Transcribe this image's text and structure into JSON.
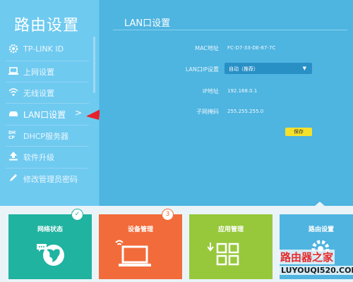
{
  "sidebar": {
    "title": "路由设置",
    "items": [
      {
        "label": "TP-LINK ID",
        "icon": "gear-icon"
      },
      {
        "label": "上网设置",
        "icon": "laptop-icon"
      },
      {
        "label": "无线设置",
        "icon": "wifi-icon"
      },
      {
        "label": "LAN口设置",
        "icon": "router-icon",
        "arrow": ">",
        "active": true
      },
      {
        "label": "DHCP服务器",
        "icon": "dhcp-icon"
      },
      {
        "label": "软件升级",
        "icon": "upload-icon"
      },
      {
        "label": "修改管理员密码",
        "icon": "pencil-icon"
      }
    ]
  },
  "main": {
    "section_title": "LAN口设置",
    "fields": {
      "mac": {
        "label": "MAC地址",
        "value": "FC-D7-33-DE-67-7C"
      },
      "lan_ip_setting": {
        "label": "LAN口IP设置",
        "value": "自动（推荐）"
      },
      "ip": {
        "label": "IP地址",
        "value": "192.168.0.1"
      },
      "mask": {
        "label": "子网掩码",
        "value": "255.255.255.0"
      }
    },
    "save_label": "保存"
  },
  "tiles": [
    {
      "label": "网络状态",
      "badge": "✓",
      "color": "#1fb3a0",
      "icon": "globe-icon"
    },
    {
      "label": "设备管理",
      "badge": "3",
      "color": "#f26b3a",
      "icon": "laptop-icon"
    },
    {
      "label": "应用管理",
      "color": "#97c83c",
      "icon": "apps-icon"
    },
    {
      "label": "路由设置",
      "color": "#4fb4e0",
      "icon": "gear-icon"
    }
  ],
  "watermark": {
    "line1": "路由器之家",
    "line2": "LUYOUQI520.COM"
  },
  "colors": {
    "annotation_arrow": "#e8212a"
  }
}
